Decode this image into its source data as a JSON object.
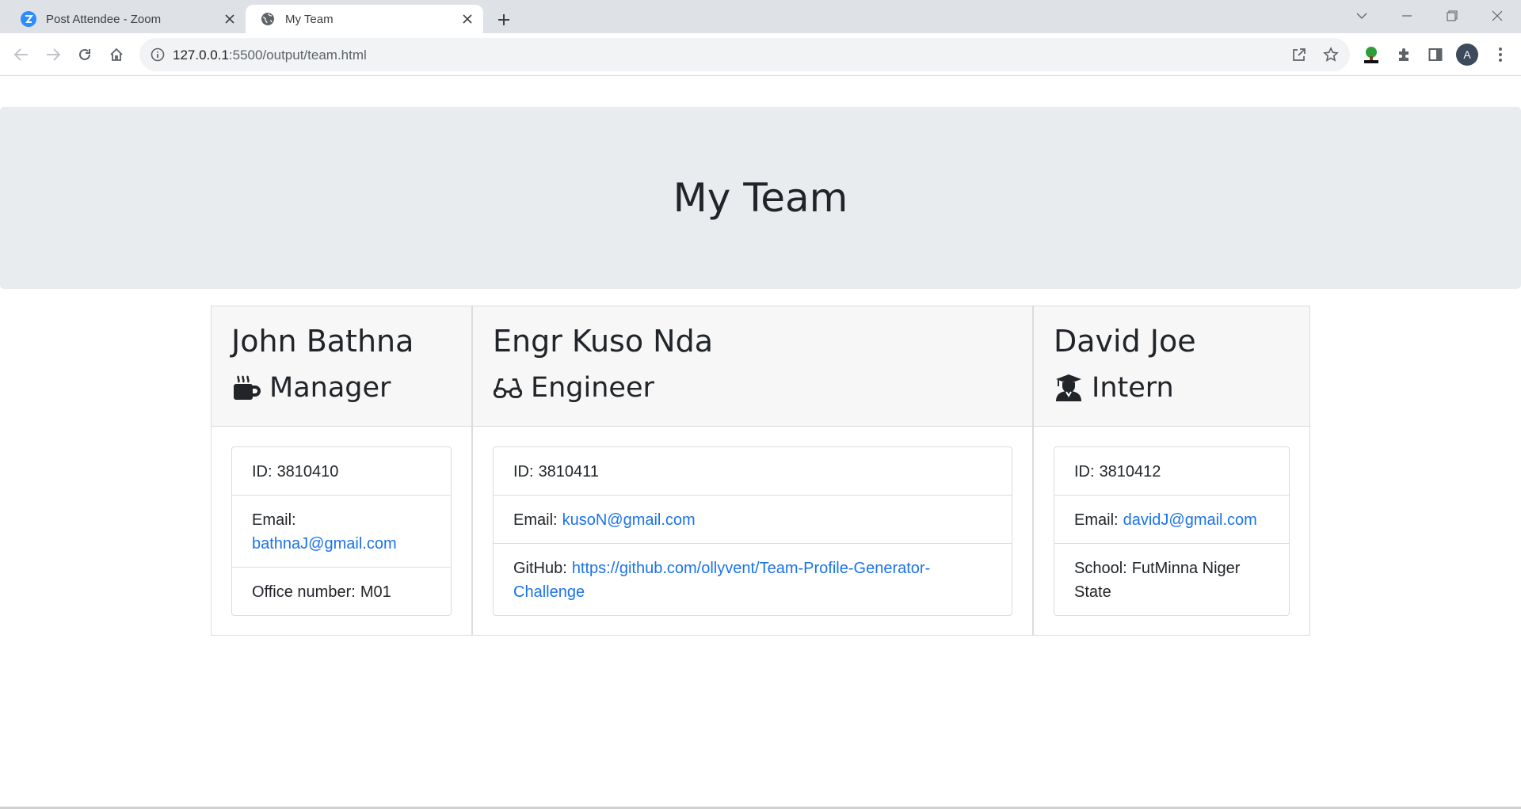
{
  "browser": {
    "tabs": [
      {
        "title": "Post Attendee - Zoom",
        "favicon": "zoom-icon",
        "active": false
      },
      {
        "title": "My Team",
        "favicon": "globe-icon",
        "active": true
      }
    ],
    "url_host": "127.0.0.1",
    "url_path": ":5500/output/team.html",
    "avatar_letter": "A"
  },
  "page": {
    "title": "My Team"
  },
  "team": [
    {
      "name": "John Bathna",
      "role": "Manager",
      "role_icon": "mug-icon",
      "id_label": "ID:",
      "id": "3810410",
      "email_label": "Email:",
      "email": "bathnaJ@gmail.com",
      "extra_label": "Office number:",
      "extra": "M01"
    },
    {
      "name": "Engr Kuso Nda",
      "role": "Engineer",
      "role_icon": "glasses-icon",
      "id_label": "ID:",
      "id": "3810411",
      "email_label": "Email:",
      "email": "kusoN@gmail.com",
      "extra_label": "GitHub:",
      "extra": "https://github.com/ollyvent/Team-Profile-Generator-Challenge"
    },
    {
      "name": "David Joe",
      "role": "Intern",
      "role_icon": "graduate-icon",
      "id_label": "ID:",
      "id": "3810412",
      "email_label": "Email:",
      "email": "davidJ@gmail.com",
      "extra_label": "School:",
      "extra": "FutMinna Niger State"
    }
  ],
  "colors": {
    "link": "#1a73e8",
    "jumbotron_bg": "#e9ecef",
    "card_header_bg": "#f7f7f7"
  }
}
